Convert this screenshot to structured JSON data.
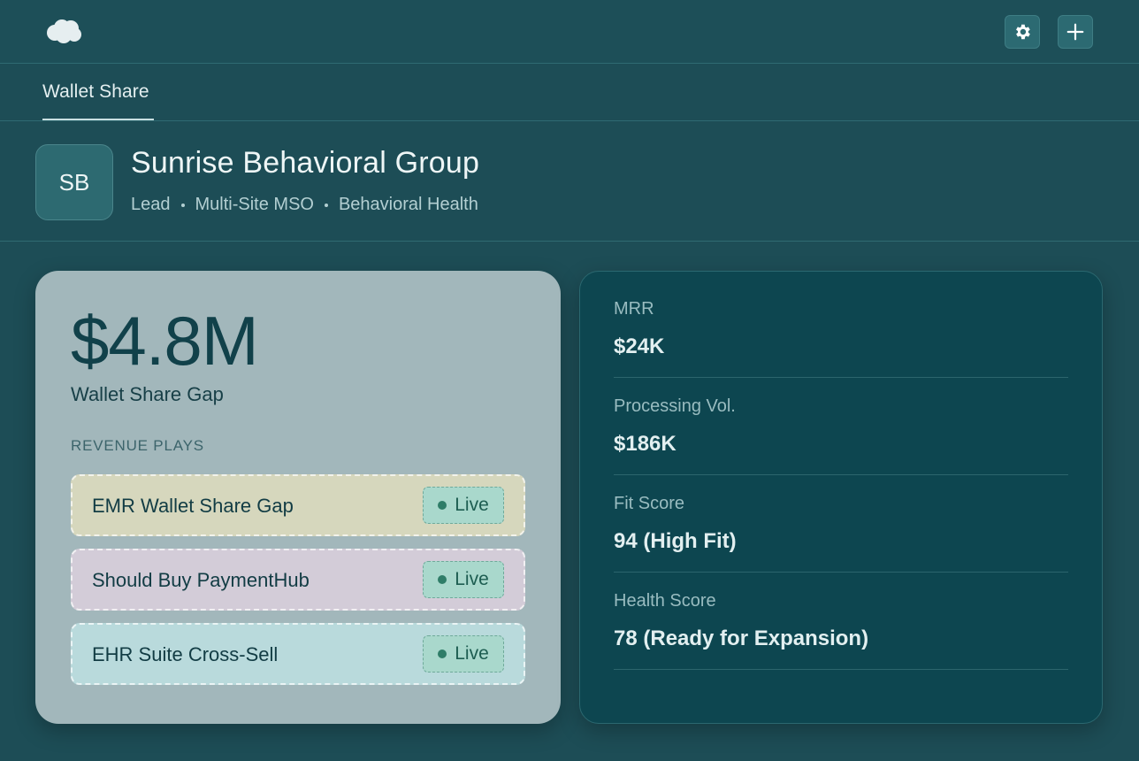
{
  "topbar": {
    "logo_icon": "cloud-logo-icon",
    "settings_icon": "gear-icon",
    "add_icon": "plus-icon"
  },
  "tabs": [
    {
      "label": "Wallet Share"
    }
  ],
  "account": {
    "initials": "SB",
    "name": "Sunrise Behavioral Group",
    "meta": [
      "Lead",
      "Multi-Site MSO",
      "Behavioral Health"
    ]
  },
  "wallet": {
    "value": "$4.8M",
    "label": "Wallet Share Gap",
    "plays_heading": "REVENUE PLAYS",
    "plays": [
      {
        "title": "EMR Wallet Share Gap",
        "status": "Live",
        "color": "#d6d7bd"
      },
      {
        "title": "Should Buy PaymentHub",
        "status": "Live",
        "color": "#d3ccd8"
      },
      {
        "title": "EHR Suite Cross-Sell",
        "status": "Live",
        "color": "#b9dadc"
      }
    ]
  },
  "metrics": [
    {
      "label": "MRR",
      "value": "$24K"
    },
    {
      "label": "Processing Vol.",
      "value": "$186K"
    },
    {
      "label": "Fit Score",
      "value": "94 (High Fit)"
    },
    {
      "label": "Health Score",
      "value": "78 (Ready for Expansion)"
    }
  ],
  "colors": {
    "background": "#1d4d56",
    "metrics_panel": "#0d4650",
    "wallet_panel": "#a2b7bb",
    "live_badge": "#a9d8cc"
  }
}
